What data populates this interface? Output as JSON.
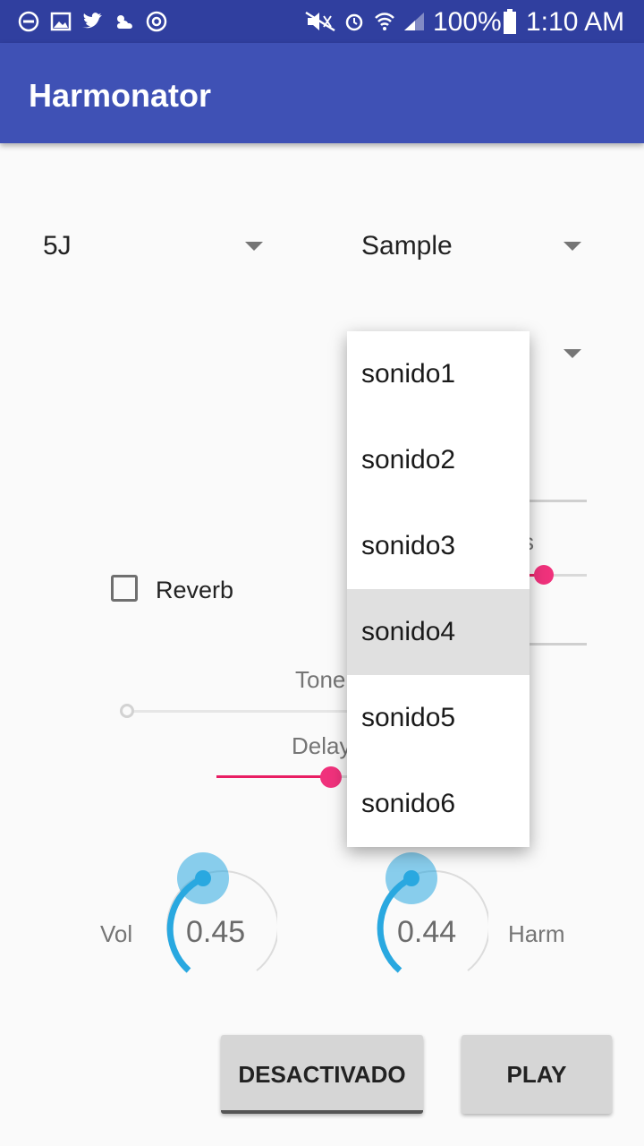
{
  "status_bar": {
    "battery": "100%",
    "time": "1:10 AM"
  },
  "app_bar": {
    "title": "Harmonator"
  },
  "spinners": {
    "key": "5J",
    "mode": "Sample"
  },
  "dropdown": {
    "items": [
      "sonido1",
      "sonido2",
      "sonido3",
      "sonido4",
      "sonido5",
      "sonido6"
    ],
    "selected_index": 3
  },
  "controls": {
    "reverb_label": "Reverb",
    "reverb_checked": false,
    "partial_label_s": "s",
    "tone_label": "Tone",
    "delay_label": "Delay",
    "tone_value": 0.0,
    "delay_value": 0.5
  },
  "knobs": {
    "vol": {
      "label": "Vol",
      "value": "0.45"
    },
    "harm": {
      "label": "Harm",
      "value": "0.44"
    }
  },
  "buttons": {
    "desactivado": "DESACTIVADO",
    "play": "PLAY"
  },
  "colors": {
    "primary": "#3f51b5",
    "primary_dark": "#303f9f",
    "accent": "#e91e63",
    "knob": "#29a8e0"
  }
}
